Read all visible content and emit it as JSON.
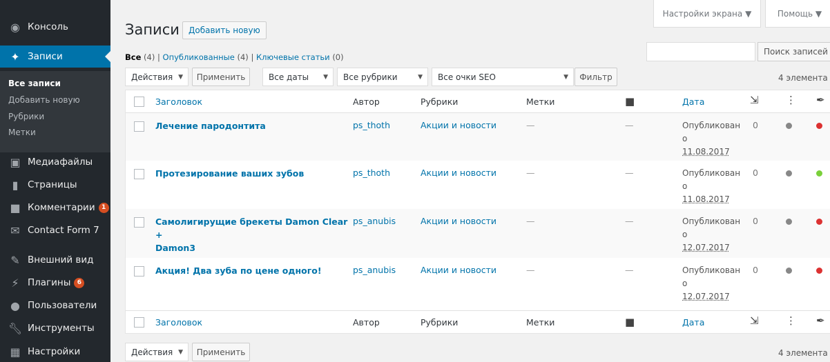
{
  "sidebar": {
    "items": [
      {
        "label": "Консоль",
        "icon": "dashboard-icon"
      },
      {
        "label": "Записи",
        "icon": "pin-icon"
      },
      {
        "label": "Медиафайлы",
        "icon": "media-icon"
      },
      {
        "label": "Страницы",
        "icon": "page-icon"
      },
      {
        "label": "Комментарии",
        "icon": "comment-icon",
        "badge": "1"
      },
      {
        "label": "Contact Form 7",
        "icon": "mail-icon"
      },
      {
        "label": "Внешний вид",
        "icon": "brush-icon"
      },
      {
        "label": "Плагины",
        "icon": "plugin-icon",
        "badge": "6"
      },
      {
        "label": "Пользователи",
        "icon": "users-icon"
      },
      {
        "label": "Инструменты",
        "icon": "wrench-icon"
      },
      {
        "label": "Настройки",
        "icon": "settings-icon"
      }
    ],
    "submenu": [
      "Все записи",
      "Добавить новую",
      "Рубрики",
      "Метки"
    ]
  },
  "screen_meta": {
    "options": "Настройки экрана ▼",
    "help": "Помощь ▼"
  },
  "header": {
    "title": "Записи",
    "add_new": "Добавить новую"
  },
  "views": {
    "all": "Все",
    "all_count": "(4)",
    "published": "Опубликованные",
    "published_count": "(4)",
    "sticky": "Ключевые статьи",
    "sticky_count": "(0)",
    "sep": "|"
  },
  "search": {
    "button": "Поиск записей"
  },
  "filters": {
    "actions": "Действия",
    "apply": "Применить",
    "dates": "Все даты",
    "categories": "Все рубрики",
    "seo": "Все очки SEO",
    "filter": "Фильтр",
    "count": "4 элемента"
  },
  "table": {
    "columns": {
      "title": "Заголовок",
      "author": "Автор",
      "categories": "Рубрики",
      "tags": "Метки",
      "date": "Дата"
    },
    "rows": [
      {
        "title": "Лечение пародонтита",
        "author": "ps_thoth",
        "category": "Акции и новости",
        "tags": "—",
        "comments": "—",
        "status1": "Опубликован",
        "status2": "о",
        "date": "11.08.2017",
        "links": "0",
        "seo_color": "#dc3232"
      },
      {
        "title": "Протезирование ваших зубов",
        "author": "ps_thoth",
        "category": "Акции и новости",
        "tags": "—",
        "comments": "—",
        "status1": "Опубликован",
        "status2": "о",
        "date": "11.08.2017",
        "links": "0",
        "seo_color": "#7ad03a"
      },
      {
        "title": "Самолигирущие брекеты Damon Clear +",
        "title2": "Damon3",
        "author": "ps_anubis",
        "category": "Акции и новости",
        "tags": "—",
        "comments": "—",
        "status1": "Опубликован",
        "status2": "о",
        "date": "12.07.2017",
        "links": "0",
        "seo_color": "#dc3232"
      },
      {
        "title": "Акция! Два зуба по цене одного!",
        "author": "ps_anubis",
        "category": "Акции и новости",
        "tags": "—",
        "comments": "—",
        "status1": "Опубликован",
        "status2": "о",
        "date": "12.07.2017",
        "links": "0",
        "seo_color": "#dc3232"
      }
    ]
  },
  "colors": {
    "accent": "#0073aa",
    "sidebar": "#23282d",
    "badge": "#d54e21",
    "readability": "#888888"
  }
}
